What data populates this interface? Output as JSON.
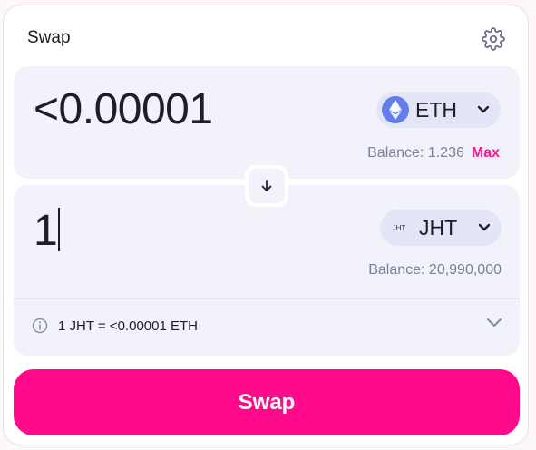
{
  "header": {
    "title": "Swap",
    "settings_icon": "gear-icon"
  },
  "from": {
    "amount": "<0.00001",
    "token": {
      "symbol": "ETH",
      "logo": "eth-logo",
      "color": "#627eea"
    },
    "balance_label": "Balance: 1.236",
    "max_label": "Max"
  },
  "to": {
    "amount": "1",
    "token": {
      "symbol": "JHT",
      "logo_text": "JHT"
    },
    "balance_label": "Balance: 20,990,000"
  },
  "switch": {
    "icon": "arrow-down-icon"
  },
  "rate": {
    "text": "1 JHT = <0.00001 ETH",
    "icon": "info-icon"
  },
  "action": {
    "swap_label": "Swap"
  },
  "colors": {
    "accent": "#fe0a8b",
    "panel_bg": "#f1f2fa",
    "token_btn_bg": "#e4e6f8",
    "muted_text": "#7a7f99"
  }
}
